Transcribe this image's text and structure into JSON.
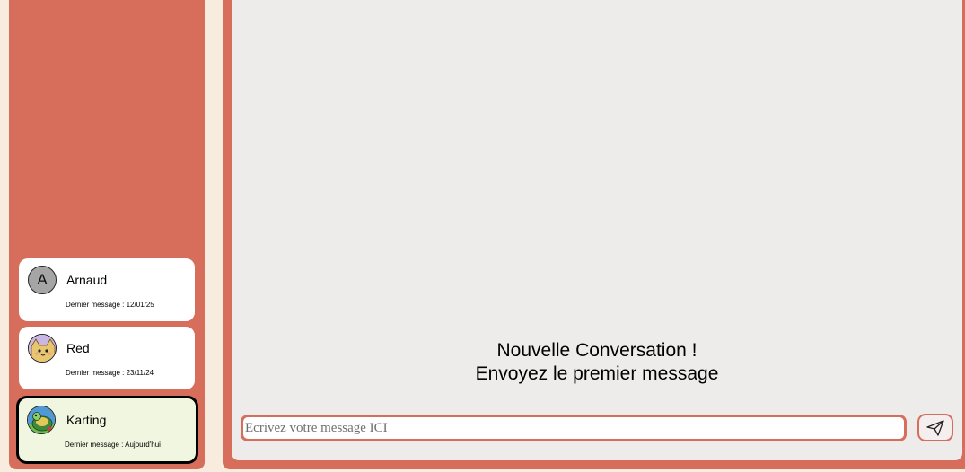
{
  "colors": {
    "accent": "#d76e5c",
    "background": "#f7ecdd",
    "chat_background": "#eeebeb",
    "active_card": "#f0f6e0"
  },
  "conversations": [
    {
      "name": "Arnaud",
      "avatar_letter": "A",
      "last_message": "Dernier message : 12/01/25",
      "active": false
    },
    {
      "name": "Red",
      "avatar_icon": "cat-avatar-icon",
      "last_message": "Dernier message : 23/11/24",
      "active": false
    },
    {
      "name": "Karting",
      "avatar_icon": "turtle-avatar-icon",
      "last_message": "Dernier message : Aujourd'hui",
      "active": true
    }
  ],
  "chat": {
    "empty_title": "Nouvelle Conversation !",
    "empty_subtitle": "Envoyez le premier message",
    "input_placeholder": "Ecrivez votre message ICI",
    "input_value": "",
    "send_icon": "paper-plane-icon"
  }
}
